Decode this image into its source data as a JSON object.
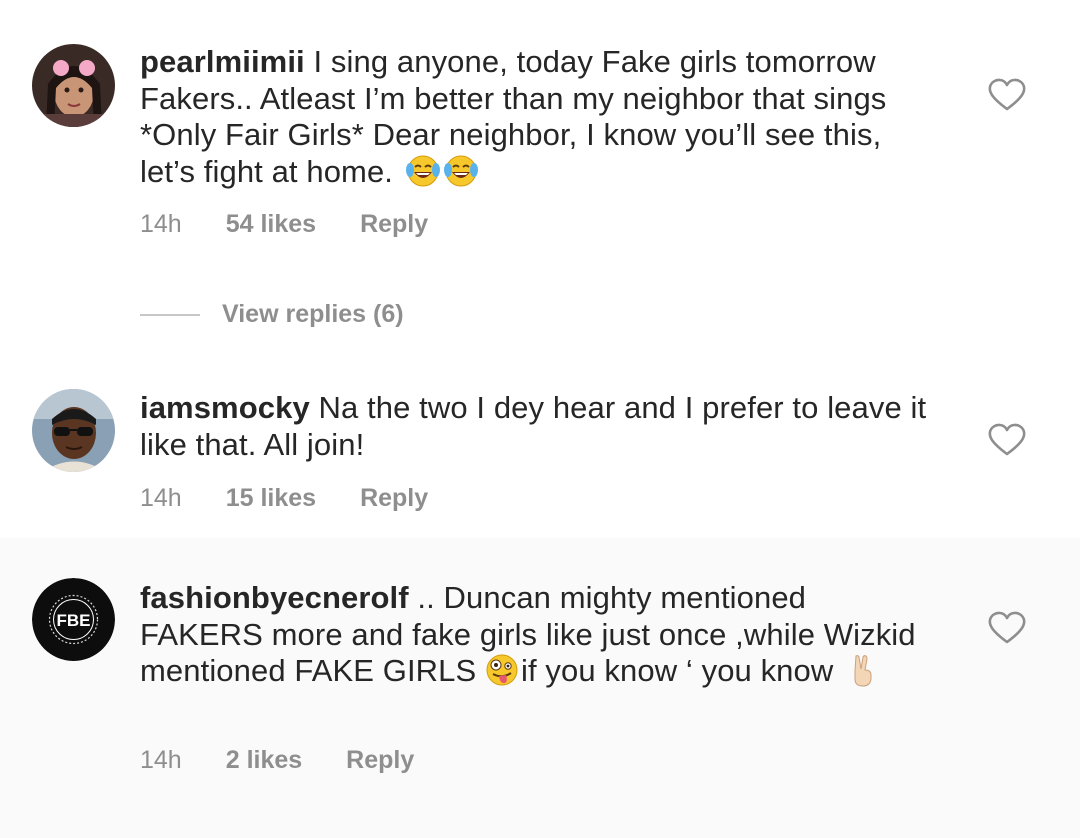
{
  "comments": [
    {
      "username": "pearlmiimii",
      "text": " I sing anyone, today Fake girls tomorrow Fakers.. Atleast I’m better than my neighbor that sings *Only Fair Girls* Dear neighbor, I know you’ll see this, let’s fight at home.",
      "emojis": [
        "tears-of-joy-emoji",
        "tears-of-joy-emoji"
      ],
      "time": "14h",
      "likes": "54 likes",
      "reply": "Reply"
    },
    {
      "username": "iamsmocky",
      "text": " Na the two I dey hear and I prefer to leave it like that. All join!",
      "time": "14h",
      "likes": "15 likes",
      "reply": "Reply"
    },
    {
      "username": "fashionbyecnerolf",
      "text_part1": " .. Duncan mighty mentioned FAKERS more and fake girls like just once ,while Wizkid mentioned FAKE GIRLS ",
      "text_part2": "if you know ‘ you know ",
      "emojis": [
        "zany-face-emoji",
        "victory-hand-emoji"
      ],
      "avatar_text": "FBE",
      "time": "14h",
      "likes": "2 likes",
      "reply": "Reply"
    }
  ],
  "view_replies": "View replies (6)",
  "colors": {
    "text": "#262626",
    "meta": "#8e8e8e",
    "highlight_bg": "#fafafa"
  }
}
